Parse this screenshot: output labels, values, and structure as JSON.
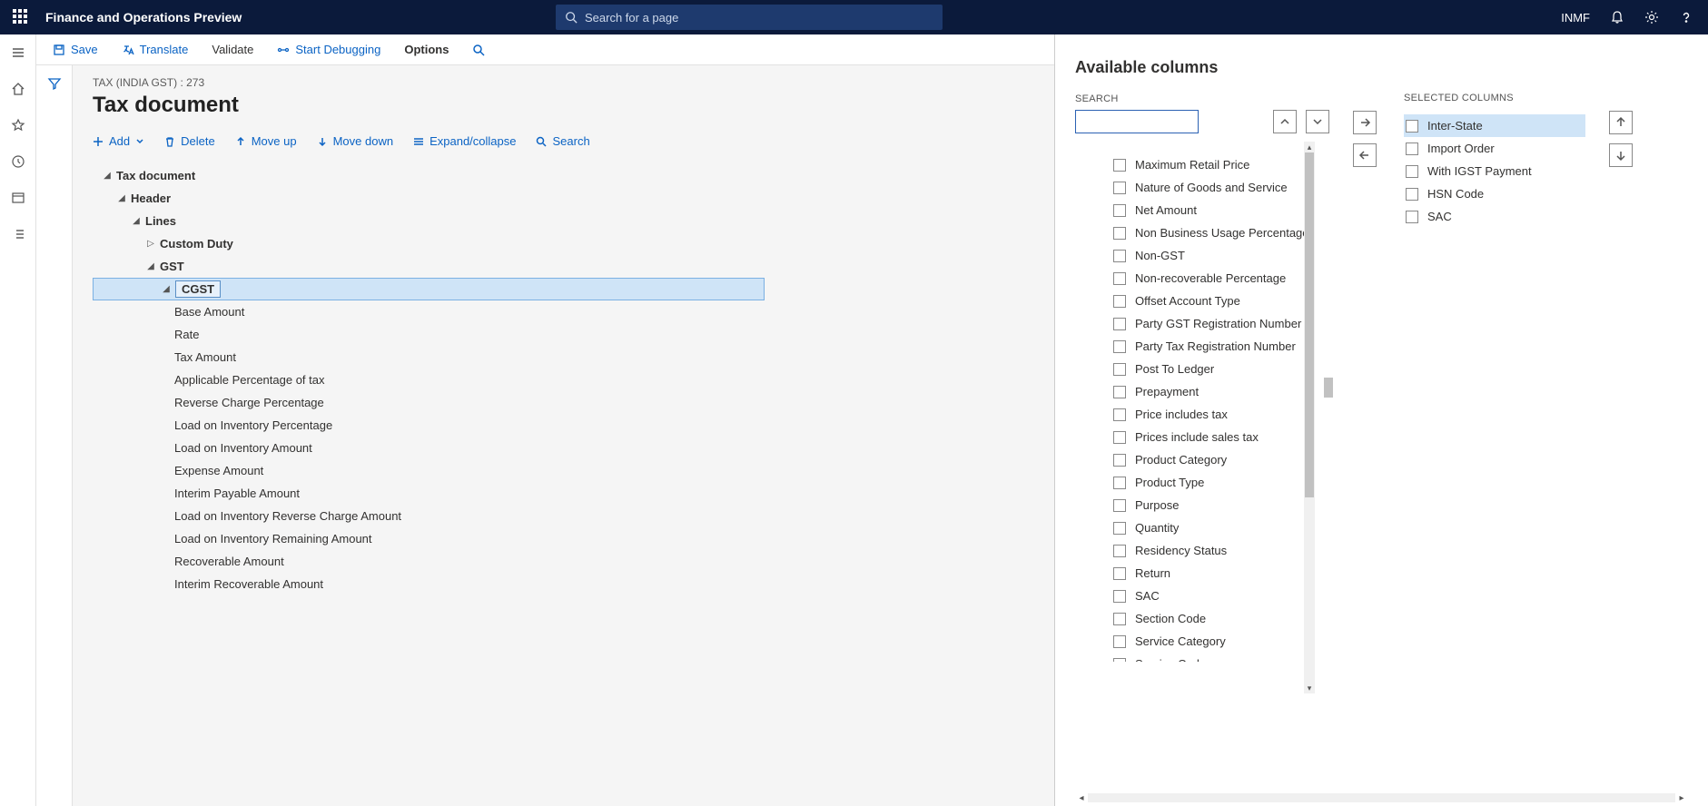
{
  "topbar": {
    "title": "Finance and Operations Preview",
    "search_placeholder": "Search for a page",
    "user": "INMF"
  },
  "cmdbar": {
    "save": "Save",
    "translate": "Translate",
    "validate": "Validate",
    "debug": "Start Debugging",
    "options": "Options"
  },
  "page": {
    "breadcrumb": "TAX (INDIA GST) : 273",
    "title": "Tax document"
  },
  "cmdrow": {
    "add": "Add",
    "delete": "Delete",
    "moveup": "Move up",
    "movedown": "Move down",
    "expand": "Expand/collapse",
    "search": "Search"
  },
  "tree": {
    "n0": "Tax document",
    "n1": "Header",
    "n2": "Lines",
    "n3": "Custom Duty",
    "n4": "GST",
    "n5": "CGST",
    "c": [
      "Base Amount",
      "Rate",
      "Tax Amount",
      "Applicable Percentage of tax",
      "Reverse Charge Percentage",
      "Load on Inventory Percentage",
      "Load on Inventory Amount",
      "Expense Amount",
      "Interim Payable Amount",
      "Load on Inventory Reverse Charge Amount",
      "Load on Inventory Remaining Amount",
      "Recoverable Amount",
      "Interim Recoverable Amount"
    ]
  },
  "panel": {
    "title": "Available columns",
    "search_label": "SEARCH",
    "selected_label": "SELECTED COLUMNS",
    "available": [
      "Maximum Retail Price",
      "Nature of Goods and Service",
      "Net Amount",
      "Non Business Usage Percentage",
      "Non-GST",
      "Non-recoverable Percentage",
      "Offset Account Type",
      "Party GST Registration Number",
      "Party Tax Registration Number",
      "Post To Ledger",
      "Prepayment",
      "Price includes tax",
      "Prices include sales tax",
      "Product Category",
      "Product Type",
      "Purpose",
      "Quantity",
      "Residency Status",
      "Return",
      "SAC",
      "Section Code",
      "Service Category",
      "Service Code"
    ],
    "selected": [
      "Inter-State",
      "Import Order",
      "With IGST Payment",
      "HSN Code",
      "SAC"
    ]
  }
}
